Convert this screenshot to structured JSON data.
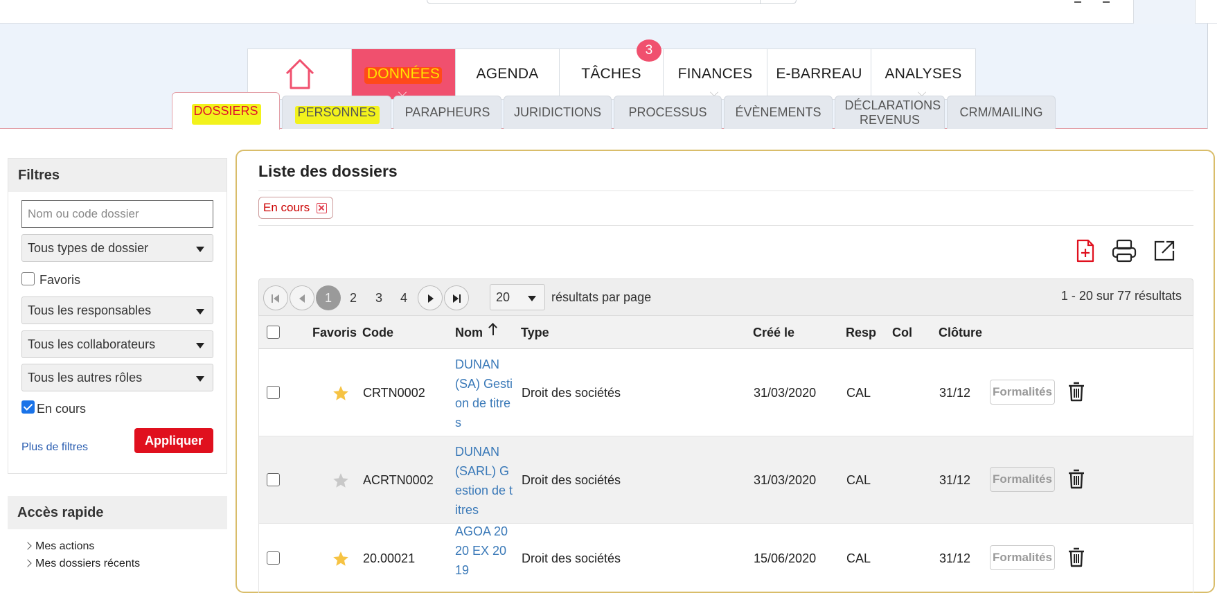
{
  "mainnav": {
    "items": [
      {
        "label": ""
      },
      {
        "label": "DONNÉES"
      },
      {
        "label": "AGENDA"
      },
      {
        "label": "TÂCHES"
      },
      {
        "label": "FINANCES"
      },
      {
        "label": "E-BARREAU"
      },
      {
        "label": "ANALYSES"
      }
    ],
    "tasks_badge": "3"
  },
  "subtabs": {
    "items": [
      {
        "label": "DOSSIERS"
      },
      {
        "label": "PERSONNES"
      },
      {
        "label": "PARAPHEURS"
      },
      {
        "label": "JURIDICTIONS"
      },
      {
        "label": "PROCESSUS"
      },
      {
        "label": "ÉVÈNEMENTS"
      },
      {
        "label": "DÉCLARATIONS REVENUS"
      },
      {
        "label": "CRM/MAILING"
      }
    ]
  },
  "filters": {
    "title": "Filtres",
    "search_placeholder": "Nom ou code dossier",
    "type_select": "Tous types de dossier",
    "favoris_label": "Favoris",
    "responsables_select": "Tous les responsables",
    "collaborateurs_select": "Tous les collaborateurs",
    "roles_select": "Tous les autres rôles",
    "en_cours_label": "En cours",
    "more_filters": "Plus de filtres",
    "apply": "Appliquer"
  },
  "quick_access": {
    "title": "Accès rapide",
    "items": [
      "Mes actions",
      "Mes dossiers récents"
    ]
  },
  "list": {
    "title": "Liste des dossiers",
    "active_filter_chip": "En cours",
    "pagination": {
      "current_page": "1",
      "pages": [
        "2",
        "3",
        "4"
      ],
      "page_size": "20",
      "per_page_label": "résultats par page",
      "results_summary": "1 - 20 sur 77 résultats"
    },
    "columns": {
      "favoris": "Favoris",
      "code": "Code",
      "nom": "Nom",
      "type": "Type",
      "cree_le": "Créé le",
      "resp": "Resp",
      "col": "Col",
      "cloture": "Clôture"
    },
    "rows": [
      {
        "favori": true,
        "code": "CRTN0002",
        "nom": "DUNAN (SA) Gestion de titres",
        "type": "Droit des sociétés",
        "cree_le": "31/03/2020",
        "resp": "CAL",
        "col": "",
        "cloture": "31/12",
        "action": "Formalités"
      },
      {
        "favori": false,
        "code": "ACRTN0002",
        "nom": "DUNAN (SARL) Gestion de titres",
        "type": "Droit des sociétés",
        "cree_le": "31/03/2020",
        "resp": "CAL",
        "col": "",
        "cloture": "31/12",
        "action": "Formalités"
      },
      {
        "favori": true,
        "code": "20.00021",
        "nom": "AGOA 2020 EX 2019",
        "type": "Droit des sociétés",
        "cree_le": "15/06/2020",
        "resp": "CAL",
        "col": "",
        "cloture": "31/12",
        "action": "Formalités"
      }
    ]
  },
  "colors": {
    "accent": "#f0506e",
    "apply_button": "#e0101e",
    "link": "#3a79b8",
    "star_active": "#f6c343",
    "star_inactive": "#c8c8c8",
    "highlight_yellow": "#f2f21c",
    "panel_border": "#d9bd6a"
  }
}
